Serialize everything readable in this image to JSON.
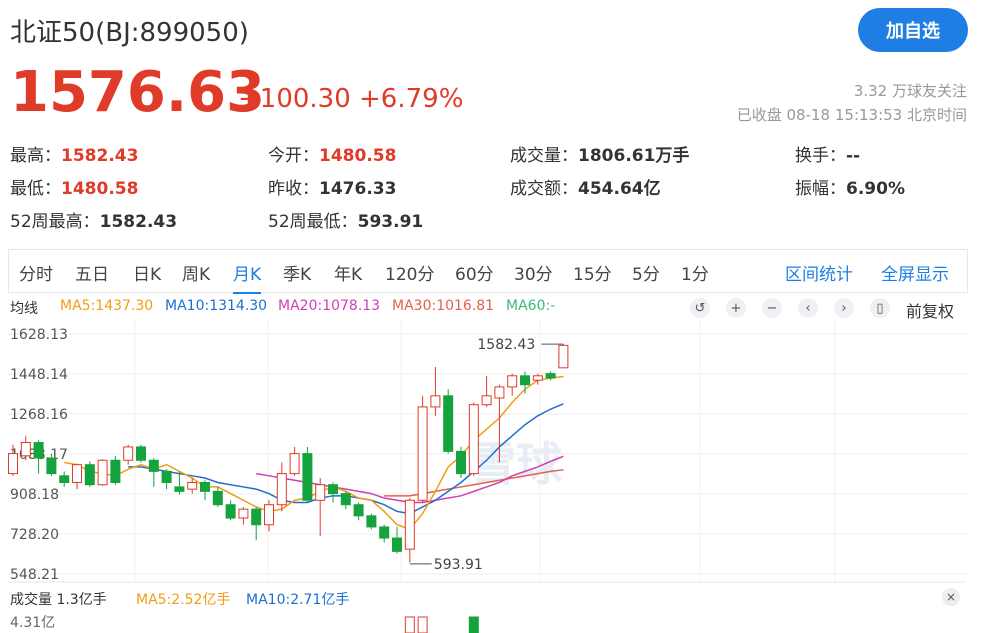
{
  "header": {
    "title": "北证50(BJ:899050)",
    "follow_label": "加自选",
    "price": "1576.63",
    "change": "+100.30 +6.79%",
    "fans": "3.32 万球友关注",
    "close_time": "已收盘 08-18 15:13:53 北京时间"
  },
  "stats": [
    {
      "label": "最高：",
      "value": "1582.43"
    },
    {
      "label": "今开：",
      "value": "1480.58"
    },
    {
      "label": "成交量：",
      "value": "1806.61万手"
    },
    {
      "label": "换手：",
      "value": "--"
    },
    {
      "label": "最低：",
      "value": "1480.58"
    },
    {
      "label": "昨收：",
      "value": "1476.33"
    },
    {
      "label": "成交额：",
      "value": "454.64亿"
    },
    {
      "label": "振幅：",
      "value": "6.90%"
    },
    {
      "label": "52周最高：",
      "value": "1582.43"
    },
    {
      "label": "52周最低：",
      "value": "593.91"
    }
  ],
  "tabs": [
    "分时",
    "五日",
    "日K",
    "周K",
    "月K",
    "季K",
    "年K",
    "120分",
    "60分",
    "30分",
    "15分",
    "5分",
    "1分"
  ],
  "tab_links": [
    "区间统计",
    "全屏显示"
  ],
  "ma": {
    "title": "均线",
    "ma5": "MA5:1437.30",
    "ma10": "MA10:1314.30",
    "ma20": "MA20:1078.13",
    "ma30": "MA30:1016.81",
    "ma60": "MA60:-"
  },
  "adjust_label": "前复权",
  "watermark": "雪球",
  "chart_data": {
    "type": "candlestick",
    "y_ticks": [
      "1628.13",
      "1448.14",
      "1268.16",
      "1088.17",
      "908.18",
      "728.20",
      "548.21"
    ],
    "ylim": [
      548.21,
      1628.13
    ],
    "annotations": {
      "high": "1582.43",
      "low": "593.91"
    },
    "candles": [
      {
        "o": 1000,
        "c": 1090,
        "h": 1130,
        "l": 990
      },
      {
        "o": 1080,
        "c": 1140,
        "h": 1170,
        "l": 1060
      },
      {
        "o": 1140,
        "c": 1070,
        "h": 1150,
        "l": 1000
      },
      {
        "o": 1070,
        "c": 1000,
        "h": 1090,
        "l": 990
      },
      {
        "o": 990,
        "c": 960,
        "h": 1010,
        "l": 940
      },
      {
        "o": 960,
        "c": 1040,
        "h": 1045,
        "l": 930
      },
      {
        "o": 1040,
        "c": 950,
        "h": 1055,
        "l": 940
      },
      {
        "o": 950,
        "c": 1060,
        "h": 1065,
        "l": 945
      },
      {
        "o": 1060,
        "c": 960,
        "h": 1080,
        "l": 950
      },
      {
        "o": 1060,
        "c": 1120,
        "h": 1130,
        "l": 1040
      },
      {
        "o": 1120,
        "c": 1060,
        "h": 1130,
        "l": 1050
      },
      {
        "o": 1060,
        "c": 1010,
        "h": 1070,
        "l": 940
      },
      {
        "o": 1010,
        "c": 960,
        "h": 1020,
        "l": 930
      },
      {
        "o": 940,
        "c": 920,
        "h": 1010,
        "l": 905
      },
      {
        "o": 930,
        "c": 960,
        "h": 980,
        "l": 910
      },
      {
        "o": 960,
        "c": 920,
        "h": 970,
        "l": 880
      },
      {
        "o": 920,
        "c": 860,
        "h": 940,
        "l": 850
      },
      {
        "o": 860,
        "c": 800,
        "h": 880,
        "l": 790
      },
      {
        "o": 800,
        "c": 840,
        "h": 850,
        "l": 770
      },
      {
        "o": 840,
        "c": 770,
        "h": 850,
        "l": 700
      },
      {
        "o": 770,
        "c": 860,
        "h": 880,
        "l": 740
      },
      {
        "o": 860,
        "c": 1000,
        "h": 1050,
        "l": 830
      },
      {
        "o": 1000,
        "c": 1090,
        "h": 1120,
        "l": 990
      },
      {
        "o": 1090,
        "c": 880,
        "h": 1120,
        "l": 870
      },
      {
        "o": 880,
        "c": 950,
        "h": 980,
        "l": 720
      },
      {
        "o": 950,
        "c": 910,
        "h": 960,
        "l": 870
      },
      {
        "o": 910,
        "c": 860,
        "h": 920,
        "l": 840
      },
      {
        "o": 860,
        "c": 810,
        "h": 870,
        "l": 790
      },
      {
        "o": 810,
        "c": 760,
        "h": 820,
        "l": 750
      },
      {
        "o": 760,
        "c": 710,
        "h": 770,
        "l": 690
      },
      {
        "o": 710,
        "c": 650,
        "h": 760,
        "l": 640
      },
      {
        "o": 660,
        "c": 880,
        "h": 890,
        "l": 600
      },
      {
        "o": 880,
        "c": 1300,
        "h": 1350,
        "l": 870
      },
      {
        "o": 1300,
        "c": 1350,
        "h": 1480,
        "l": 1260
      },
      {
        "o": 1350,
        "c": 1100,
        "h": 1380,
        "l": 1090
      },
      {
        "o": 1100,
        "c": 1000,
        "h": 1120,
        "l": 980
      },
      {
        "o": 1000,
        "c": 1310,
        "h": 1320,
        "l": 990
      },
      {
        "o": 1310,
        "c": 1350,
        "h": 1440,
        "l": 1300
      },
      {
        "o": 1340,
        "c": 1390,
        "h": 1400,
        "l": 1050
      },
      {
        "o": 1390,
        "c": 1440,
        "h": 1450,
        "l": 1350
      },
      {
        "o": 1440,
        "c": 1400,
        "h": 1460,
        "l": 1360
      },
      {
        "o": 1420,
        "c": 1440,
        "h": 1450,
        "l": 1400
      },
      {
        "o": 1450,
        "c": 1430,
        "h": 1460,
        "l": 1420
      },
      {
        "o": 1476,
        "c": 1577,
        "h": 1582,
        "l": 1476
      }
    ],
    "ma5": [
      null,
      null,
      null,
      null,
      1050,
      1040,
      1010,
      1000,
      990,
      1020,
      1040,
      1020,
      1040,
      1010,
      980,
      940,
      940,
      910,
      880,
      850,
      830,
      840,
      880,
      890,
      920,
      940,
      920,
      890,
      880,
      830,
      770,
      750,
      820,
      920,
      1030,
      1080,
      1150,
      1200,
      1250,
      1320,
      1380,
      1420,
      1430,
      1437
    ],
    "ma10": [
      null,
      null,
      null,
      null,
      null,
      null,
      null,
      null,
      null,
      1030,
      1030,
      1020,
      1010,
      1000,
      990,
      980,
      960,
      950,
      940,
      930,
      910,
      880,
      870,
      870,
      890,
      900,
      900,
      890,
      880,
      860,
      830,
      820,
      850,
      880,
      920,
      960,
      1010,
      1060,
      1120,
      1170,
      1220,
      1260,
      1290,
      1314
    ],
    "ma20": [
      null,
      null,
      null,
      null,
      null,
      null,
      null,
      null,
      null,
      null,
      null,
      null,
      null,
      null,
      null,
      null,
      null,
      null,
      null,
      1000,
      990,
      980,
      970,
      960,
      950,
      940,
      930,
      920,
      910,
      890,
      880,
      870,
      870,
      880,
      890,
      900,
      920,
      940,
      960,
      990,
      1010,
      1030,
      1055,
      1078
    ],
    "ma30": [
      null,
      null,
      null,
      null,
      null,
      null,
      null,
      null,
      null,
      null,
      null,
      null,
      null,
      null,
      null,
      null,
      null,
      null,
      null,
      null,
      null,
      null,
      null,
      null,
      null,
      null,
      null,
      null,
      null,
      900,
      900,
      900,
      910,
      920,
      930,
      940,
      950,
      960,
      970,
      980,
      990,
      1000,
      1010,
      1017
    ],
    "volume": {
      "label": "成交量 1.3亿手",
      "ma5": "MA5:2.52亿手",
      "ma10": "MA10:2.71亿手",
      "top_tick": "4.31亿"
    }
  }
}
